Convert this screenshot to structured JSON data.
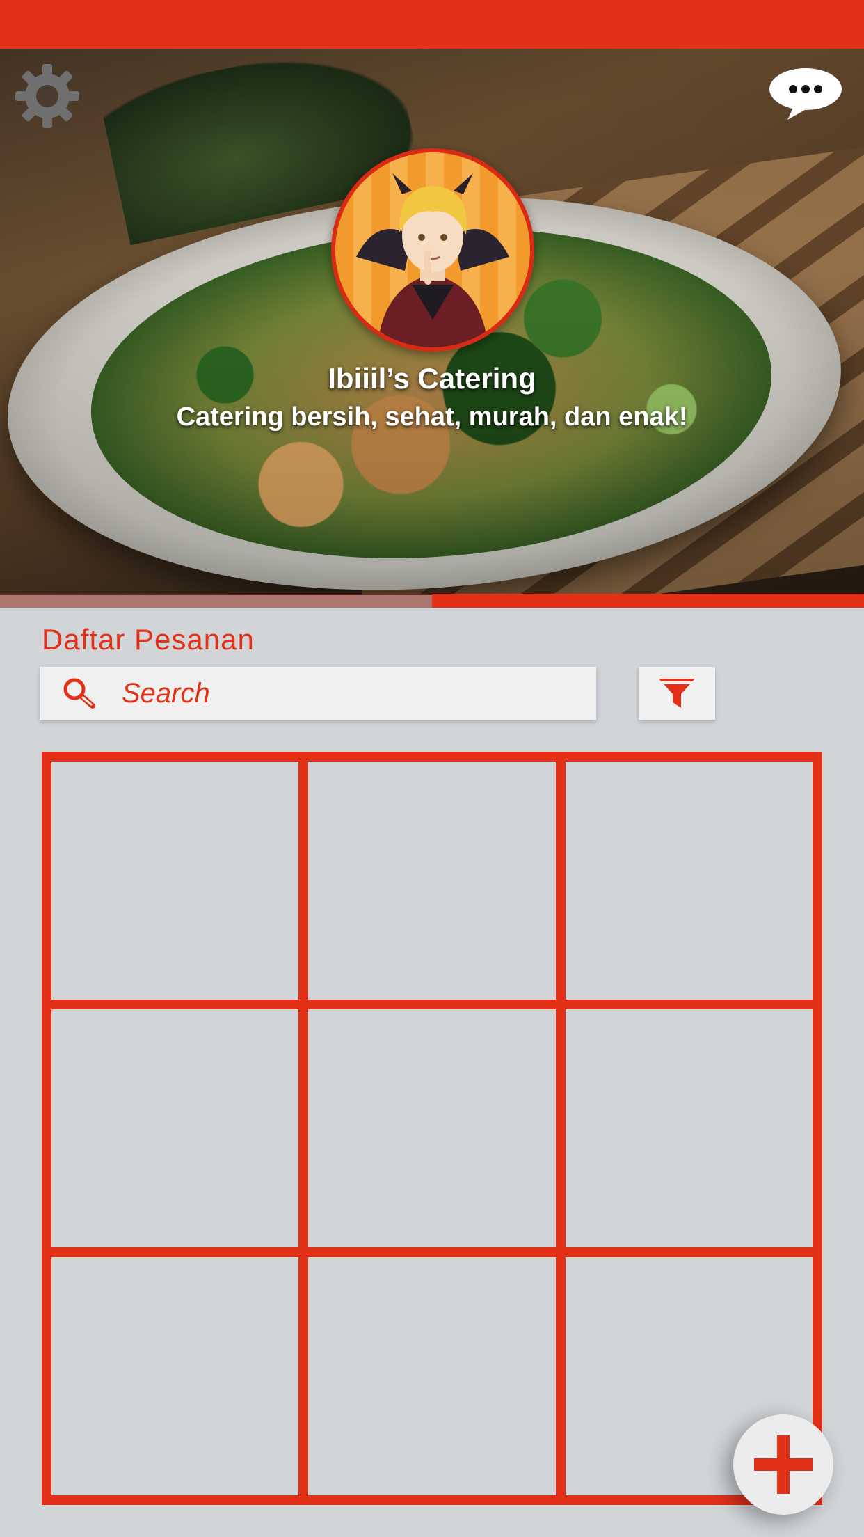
{
  "header": {
    "store_name": "Ibiiil’s Catering",
    "tagline": "Catering bersih, sehat, murah, dan enak!",
    "carousel_progress": 0.5
  },
  "icons": {
    "settings": "gear-icon",
    "messages": "chat-bubble-icon",
    "search": "search-icon",
    "filter": "filter-icon",
    "add": "plus-icon"
  },
  "orders": {
    "title": "Daftar Pesanan",
    "search_placeholder": "Search",
    "cell_count": 9
  },
  "colors": {
    "accent": "#e33118",
    "background": "#d1d5d8",
    "field": "#f0f0f0"
  }
}
